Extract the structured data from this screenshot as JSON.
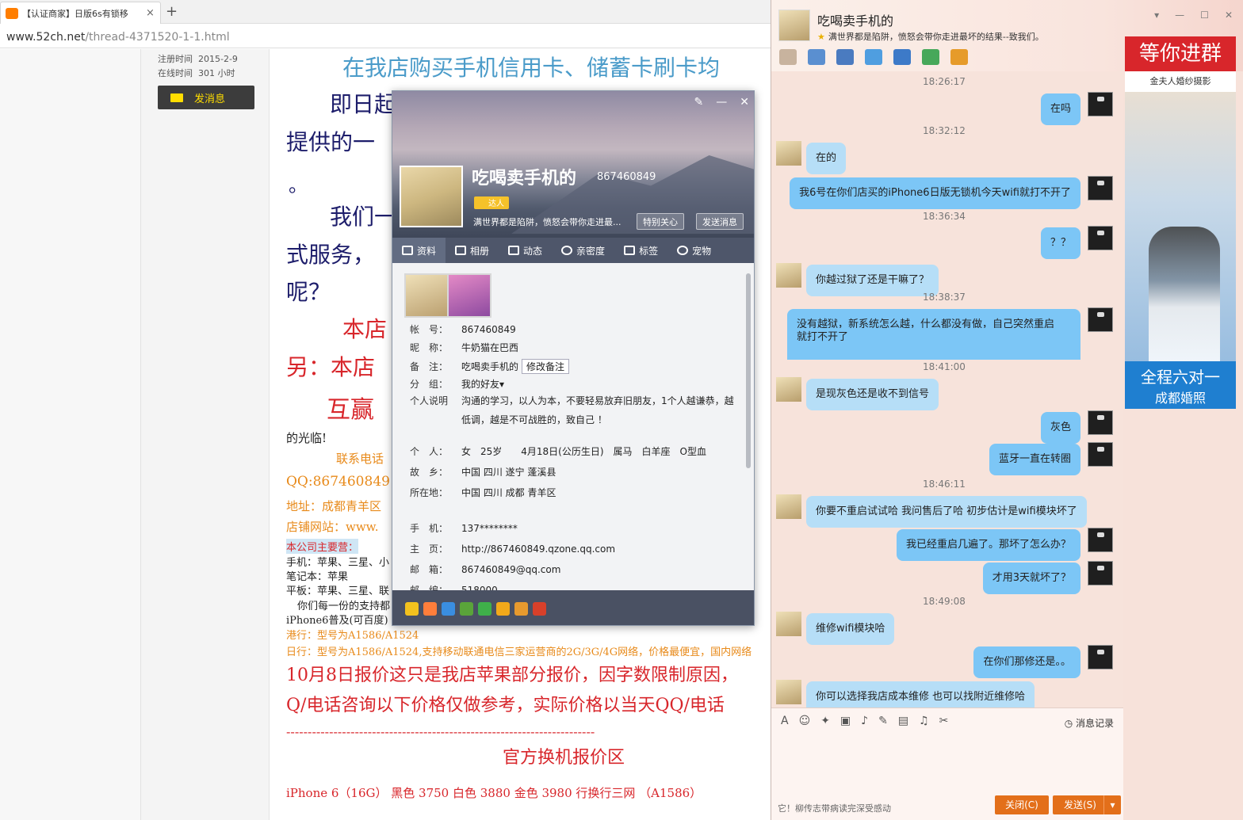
{
  "browser": {
    "tab_title": "【认证商家】日版6s有锁移",
    "tab_close": "×",
    "new_tab": "+",
    "url_host": "www.52ch.net",
    "url_path": "/thread-4371520-1-1.html"
  },
  "user_panel": {
    "reg_label": "注册时间",
    "reg_value": "2015-2-9",
    "online_label": "在线时间",
    "online_value": "301 小时",
    "message_button": "发消息"
  },
  "post": {
    "lines": [
      {
        "text": "在我店购买手机信用卡、储蓄卡刷卡均",
        "color": "#4a9bc9",
        "size": 28
      },
      {
        "text": "即日起",
        "color": "#1d1d6b",
        "size": 28
      },
      {
        "text": "提供的一",
        "color": "#1d1d6b",
        "size": 28
      },
      {
        "text": "。",
        "color": "#1d1d6b",
        "size": 24
      },
      {
        "text": "我们一",
        "color": "#1d1d6b",
        "size": 28
      },
      {
        "text": "式服务，",
        "color": "#1d1d6b",
        "size": 28
      },
      {
        "text": "呢？",
        "color": "#1d1d6b",
        "size": 28
      },
      {
        "text": "本店",
        "color": "#d8262b",
        "size": 28
      },
      {
        "text": "另：本店",
        "color": "#d8262b",
        "size": 28
      },
      {
        "text": "互赢",
        "color": "#d8262b",
        "size": 30
      },
      {
        "text": "的光临!",
        "color": "#222",
        "size": 15
      },
      {
        "text": "联系电话",
        "color": "#e88a1a",
        "size": 15
      },
      {
        "text": "QQ:867460849",
        "color": "#e88a1a",
        "size": 17
      },
      {
        "text": "地址：成都青羊区",
        "color": "#e88a1a",
        "size": 15
      },
      {
        "text": "店铺网站：www.",
        "color": "#e88a1a",
        "size": 15
      },
      {
        "text": "本公司主要营：",
        "color": "#d8262b",
        "size": 13
      },
      {
        "text": "手机：苹果、三星、小",
        "color": "#222",
        "size": 13
      },
      {
        "text": "笔记本：苹果",
        "color": "#222",
        "size": 13
      },
      {
        "text": "平板：苹果、三星、联",
        "color": "#222",
        "size": 13
      },
      {
        "text": "你们每一份的支持都",
        "color": "#222",
        "size": 13
      },
      {
        "text": "iPhone6普及(可百度)",
        "color": "#222",
        "size": 13
      },
      {
        "text": "港行：型号为A1586/A1524",
        "color": "#e88a1a",
        "size": 13
      },
      {
        "text": "日行：型号为A1586/A1524,支持移动联通电信三家运营商的2G/3G/4G网络，价格最便宜，国内网络",
        "color": "#e88a1a",
        "size": 13
      },
      {
        "text": "10月8日报价这只是我店苹果部分报价，因字数限制原因，",
        "color": "#d8262b",
        "size": 22
      },
      {
        "text": "Q/电话咨询以下价格仅做参考，实际价格以当天QQ/电话",
        "color": "#d8262b",
        "size": 22
      },
      {
        "text": "------------------------------------------------------------------------",
        "color": "#d8262b",
        "size": 16
      },
      {
        "text": "官方换机报价区",
        "color": "#d8262b",
        "size": 22
      },
      {
        "text": "iPhone 6（16G）   黑色  3750  白色 3880  金色 3980 行换行三网 （A1586）",
        "color": "#d8262b",
        "size": 15
      }
    ]
  },
  "profile": {
    "controls": [
      "✎",
      "—",
      "✕"
    ],
    "name": "吃喝卖手机的",
    "qq": "867460849",
    "badge": "达人",
    "signature": "满世界都是陷阱，愤怒会带你走进最...",
    "care_button": "特别关心",
    "send_button": "发送消息",
    "tabs": [
      "资料",
      "相册",
      "动态",
      "亲密度",
      "标签",
      "宠物"
    ],
    "fields": [
      {
        "k": "帐　号：",
        "v": "867460849"
      },
      {
        "k": "昵　称：",
        "v": "牛奶猫在巴西"
      },
      {
        "k": "备　注：",
        "v": "吃喝卖手机的"
      },
      {
        "k": "分　组：",
        "v": "我的好友▾"
      },
      {
        "k": "个人说明",
        "v": "沟通的学习，以人为本，不要轻易放弃旧朋友，1个人越谦恭，越"
      },
      {
        "k": "",
        "v": "低调，越是不可战胜的，致自己 ！"
      },
      {
        "k": "个　人：",
        "v": "女　25岁　　4月18日(公历生日)　属马　白羊座　O型血"
      },
      {
        "k": "故　乡：",
        "v": "中国 四川 遂宁 蓬溪县"
      },
      {
        "k": "所在地：",
        "v": "中国 四川 成都 青羊区"
      },
      {
        "k": "手　机：",
        "v": "137********"
      },
      {
        "k": "主　页：",
        "v": "http://867460849.qzone.qq.com"
      },
      {
        "k": "邮　箱：",
        "v": "867460849@qq.com"
      },
      {
        "k": "邮　编：",
        "v": "518000"
      }
    ],
    "edit_remark": "修改备注"
  },
  "chat": {
    "title": "吃喝卖手机的",
    "signature": "满世界都是陷阱，愤怒会带你走进最坏的结果--致我们。",
    "controls": [
      "▾",
      "—",
      "☐",
      "✕"
    ],
    "messages": [
      {
        "type": "ts",
        "text": "18:26:17"
      },
      {
        "type": "me",
        "text": "在吗"
      },
      {
        "type": "ts",
        "text": "18:32:12"
      },
      {
        "type": "them",
        "text": "在的"
      },
      {
        "type": "me",
        "text": "我6号在你们店买的iPhone6日版无锁机今天wifi就打不开了"
      },
      {
        "type": "ts",
        "text": "18:36:34"
      },
      {
        "type": "me",
        "text": "？？"
      },
      {
        "type": "them",
        "text": "你越过狱了还是干嘛了？"
      },
      {
        "type": "ts",
        "text": "18:38:37"
      },
      {
        "type": "me",
        "text": "没有越狱，新系统怎么越，什么都没有做，自己突然重启wifi"
      },
      {
        "type": "me2",
        "text": "就打不开了"
      },
      {
        "type": "ts",
        "text": "18:41:00"
      },
      {
        "type": "them",
        "text": "是现灰色还是收不到信号"
      },
      {
        "type": "me",
        "text": "灰色"
      },
      {
        "type": "me",
        "text": "蓝牙一直在转圈"
      },
      {
        "type": "ts",
        "text": "18:46:11"
      },
      {
        "type": "them",
        "text": "你要不重启试试哈 我问售后了哈 初步估计是wifi模块坏了"
      },
      {
        "type": "me",
        "text": "我已经重启几遍了。那坏了怎么办？"
      },
      {
        "type": "me",
        "text": "才用3天就坏了？"
      },
      {
        "type": "ts",
        "text": "18:49:08"
      },
      {
        "type": "them",
        "text": "维修wifi模块哈"
      },
      {
        "type": "me",
        "text": "在你们那修还是。。"
      },
      {
        "type": "them",
        "text": "你可以选择我店成本维修 也可以找附近维修哈"
      }
    ],
    "history": "消息记录",
    "tip": "它！柳传志带病读完深受感动",
    "close_button": "关闭(C)",
    "send_button": "发送(S)",
    "send_dropdown": "▾"
  },
  "ad": {
    "top": "等你进群",
    "brand": "金夫人婚纱摄影",
    "line1": "全程六对一",
    "line2": "成都婚照"
  }
}
